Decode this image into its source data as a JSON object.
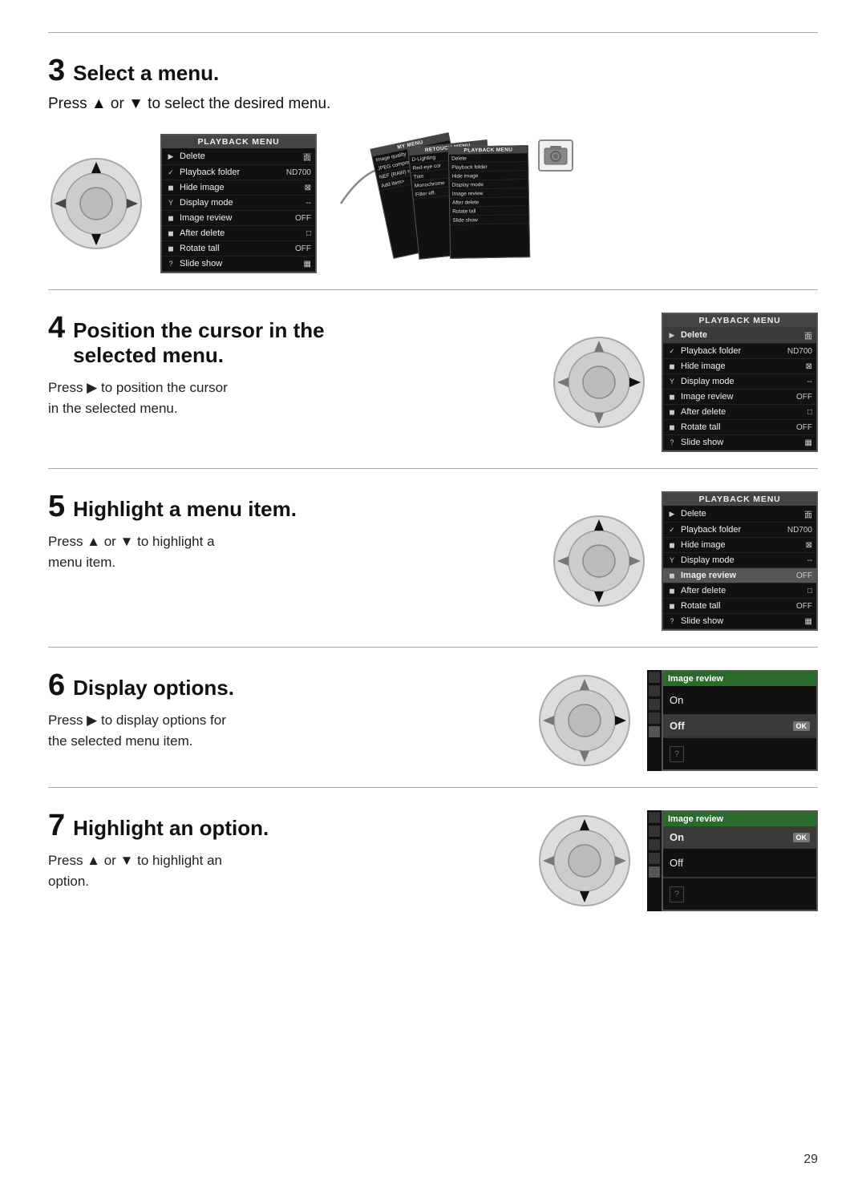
{
  "page": {
    "number": "29"
  },
  "sections": {
    "s3": {
      "number": "3",
      "title": "Select a menu.",
      "intro": "Press ▲ or ▼ to select the desired menu.",
      "menu": {
        "title": "PLAYBACK MENU",
        "rows": [
          {
            "icon": "▶",
            "label": "Delete",
            "value": "面",
            "state": "normal"
          },
          {
            "icon": "✓",
            "label": "Playback folder",
            "value": "ND700",
            "state": "normal"
          },
          {
            "icon": "◼",
            "label": "Hide image",
            "value": "⊠",
            "state": "normal"
          },
          {
            "icon": "Y",
            "label": "Display mode",
            "value": "--",
            "state": "normal"
          },
          {
            "icon": "◼",
            "label": "Image review",
            "value": "OFF",
            "state": "normal"
          },
          {
            "icon": "◼",
            "label": "After delete",
            "value": "□",
            "state": "normal"
          },
          {
            "icon": "◼",
            "label": "Rotate tall",
            "value": "OFF",
            "state": "normal"
          },
          {
            "icon": "?",
            "label": "Slide show",
            "value": "▦",
            "state": "normal"
          }
        ]
      }
    },
    "s4": {
      "number": "4",
      "title": "Position the cursor in the selected menu.",
      "description": "Press ▶ to position the cursor\nin the selected menu.",
      "menu": {
        "title": "PLAYBACK MENU",
        "rows": [
          {
            "icon": "▶",
            "label": "Delete",
            "value": "面",
            "state": "highlighted"
          },
          {
            "icon": "✓",
            "label": "Playback folder",
            "value": "ND700",
            "state": "normal"
          },
          {
            "icon": "◼",
            "label": "Hide image",
            "value": "⊠",
            "state": "normal"
          },
          {
            "icon": "Y",
            "label": "Display mode",
            "value": "--",
            "state": "normal"
          },
          {
            "icon": "◼",
            "label": "Image review",
            "value": "OFF",
            "state": "normal"
          },
          {
            "icon": "◼",
            "label": "After delete",
            "value": "□",
            "state": "normal"
          },
          {
            "icon": "◼",
            "label": "Rotate tall",
            "value": "OFF",
            "state": "normal"
          },
          {
            "icon": "?",
            "label": "Slide show",
            "value": "▦",
            "state": "normal"
          }
        ]
      }
    },
    "s5": {
      "number": "5",
      "title": "Highlight a menu item.",
      "description": "Press ▲ or ▼ to highlight a\nmenu item.",
      "menu": {
        "title": "PLAYBACK MENU",
        "rows": [
          {
            "icon": "▶",
            "label": "Delete",
            "value": "面",
            "state": "normal"
          },
          {
            "icon": "✓",
            "label": "Playback folder",
            "value": "ND700",
            "state": "normal"
          },
          {
            "icon": "◼",
            "label": "Hide image",
            "value": "⊠",
            "state": "normal"
          },
          {
            "icon": "Y",
            "label": "Display mode",
            "value": "--",
            "state": "normal"
          },
          {
            "icon": "◼",
            "label": "Image review",
            "value": "OFF",
            "state": "selected"
          },
          {
            "icon": "◼",
            "label": "After delete",
            "value": "□",
            "state": "normal"
          },
          {
            "icon": "◼",
            "label": "Rotate tall",
            "value": "OFF",
            "state": "normal"
          },
          {
            "icon": "?",
            "label": "Slide show",
            "value": "▦",
            "state": "normal"
          }
        ]
      }
    },
    "s6": {
      "number": "6",
      "title": "Display options.",
      "description": "Press ▶ to display options for\nthe selected menu item.",
      "review_menu": {
        "title": "Image review",
        "rows": [
          {
            "label": "On",
            "state": "normal",
            "ok": false
          },
          {
            "label": "Off",
            "state": "highlighted",
            "ok": true
          }
        ]
      }
    },
    "s7": {
      "number": "7",
      "title": "Highlight an option.",
      "description": "Press ▲ or ▼ to highlight an\noption.",
      "review_menu": {
        "title": "Image review",
        "rows": [
          {
            "label": "On",
            "state": "highlighted",
            "ok": true
          },
          {
            "label": "Off",
            "state": "normal",
            "ok": false
          }
        ]
      }
    }
  }
}
